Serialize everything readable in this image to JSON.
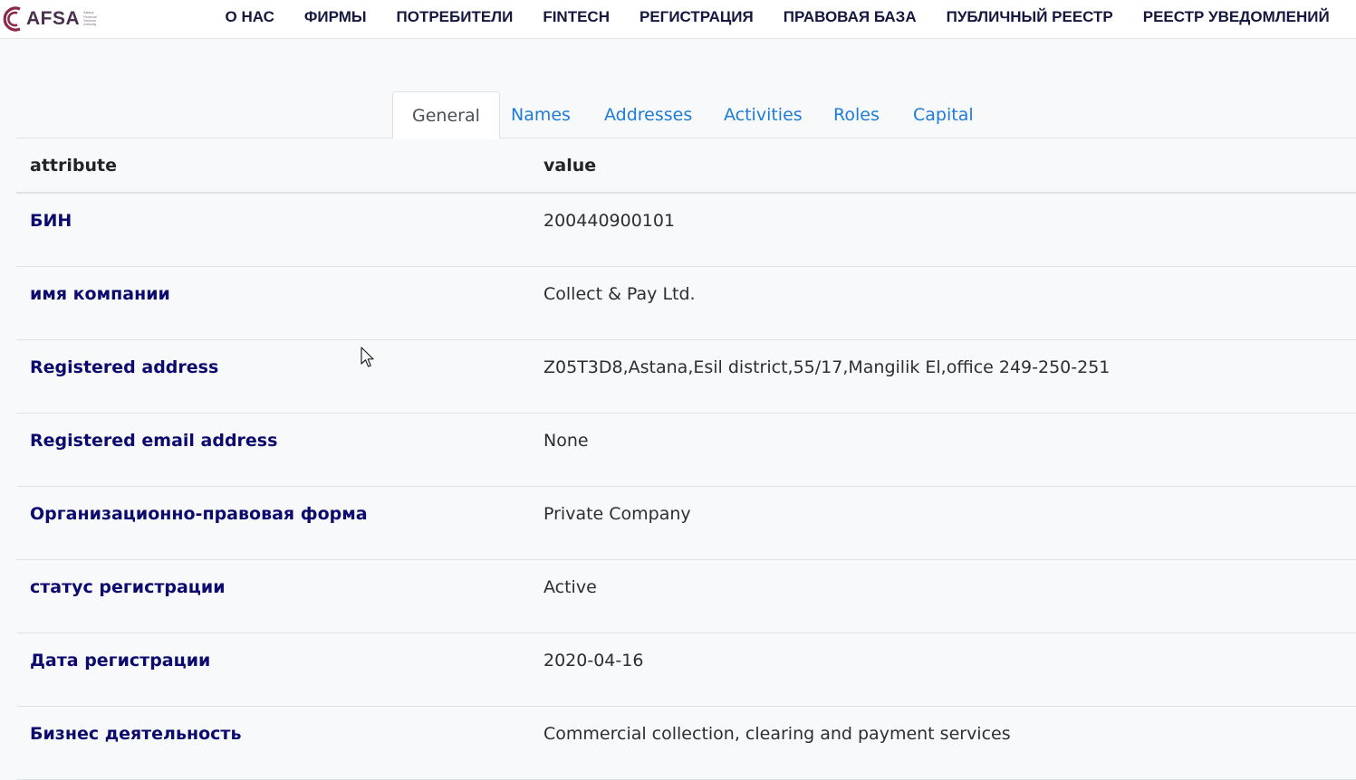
{
  "header": {
    "logo_text": "AFSA",
    "logo_sub": [
      "Astana",
      "Financial",
      "Services",
      "Authority"
    ],
    "brand_color": "#4a2f4f",
    "nav": [
      "О НАС",
      "ФИРМЫ",
      "ПОТРЕБИТЕЛИ",
      "FINTECH",
      "РЕГИСТРАЦИЯ",
      "ПРАВОВАЯ БАЗА",
      "ПУБЛИЧНЫЙ РЕЕСТР",
      "РЕЕСТР УВЕДОМЛЕНИЙ"
    ]
  },
  "tabs": [
    {
      "label": "General",
      "active": true
    },
    {
      "label": "Names",
      "active": false
    },
    {
      "label": "Addresses",
      "active": false
    },
    {
      "label": "Activities",
      "active": false
    },
    {
      "label": "Roles",
      "active": false
    },
    {
      "label": "Capital",
      "active": false
    }
  ],
  "table": {
    "headers": [
      "attribute",
      "value"
    ],
    "rows": [
      {
        "attribute": "БИН",
        "value": "200440900101"
      },
      {
        "attribute": "имя компании",
        "value": "Collect & Pay Ltd."
      },
      {
        "attribute": "Registered address",
        "value": "Z05T3D8,Astana,Esil district,55/17,Mangilik El,office 249-250-251"
      },
      {
        "attribute": "Registered email address",
        "value": "None"
      },
      {
        "attribute": "Организационно-правовая форма",
        "value": "Private Company"
      },
      {
        "attribute": "статус регистрации",
        "value": "Active"
      },
      {
        "attribute": "Дата регистрации",
        "value": "2020-04-16"
      },
      {
        "attribute": "Бизнес деятельность",
        "value": "Commercial collection, clearing and payment services"
      }
    ]
  },
  "colors": {
    "link": "#1f7bd8",
    "attribute_text": "#0c0a6e",
    "nav_text": "#15173f",
    "page_bg": "#f8f9fa"
  }
}
